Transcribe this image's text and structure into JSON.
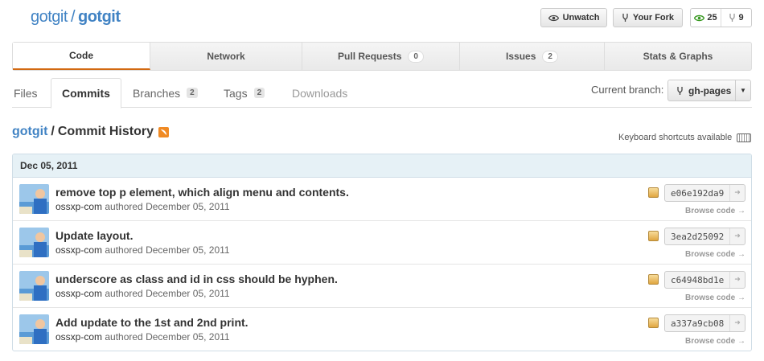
{
  "repo": {
    "owner": "gotgit",
    "separator": "/",
    "name": "gotgit"
  },
  "actions": {
    "unwatch": "Unwatch",
    "fork": "Your Fork",
    "watchers": "25",
    "forks": "9"
  },
  "tabs": [
    {
      "label": "Code",
      "count": null
    },
    {
      "label": "Network",
      "count": null
    },
    {
      "label": "Pull Requests",
      "count": "0"
    },
    {
      "label": "Issues",
      "count": "2"
    },
    {
      "label": "Stats & Graphs",
      "count": null
    }
  ],
  "subnav": {
    "files": "Files",
    "commits": "Commits",
    "branches": "Branches",
    "branches_count": "2",
    "tags": "Tags",
    "tags_count": "2",
    "downloads": "Downloads"
  },
  "branch": {
    "label": "Current branch:",
    "value": "gh-pages"
  },
  "history": {
    "owner": "gotgit",
    "separator": "/",
    "title": "Commit History",
    "keyboard_note": "Keyboard shortcuts available"
  },
  "group": {
    "date": "Dec 05, 2011"
  },
  "commits": [
    {
      "message": "remove top p element, which align menu and contents.",
      "author": "ossxp-com",
      "verb": "authored",
      "date": "December 05, 2011",
      "sha": "e06e192da9",
      "browse": "Browse code"
    },
    {
      "message": "Update layout.",
      "author": "ossxp-com",
      "verb": "authored",
      "date": "December 05, 2011",
      "sha": "3ea2d25092",
      "browse": "Browse code"
    },
    {
      "message": "underscore as class and id in css should be hyphen.",
      "author": "ossxp-com",
      "verb": "authored",
      "date": "December 05, 2011",
      "sha": "c64948bd1e",
      "browse": "Browse code"
    },
    {
      "message": "Add update to the 1st and 2nd print.",
      "author": "ossxp-com",
      "verb": "authored",
      "date": "December 05, 2011",
      "sha": "a337a9cb08",
      "browse": "Browse code"
    }
  ],
  "colors": {
    "link": "#4183c4",
    "accent": "#d26911",
    "group_header": "#e6f1f6"
  }
}
